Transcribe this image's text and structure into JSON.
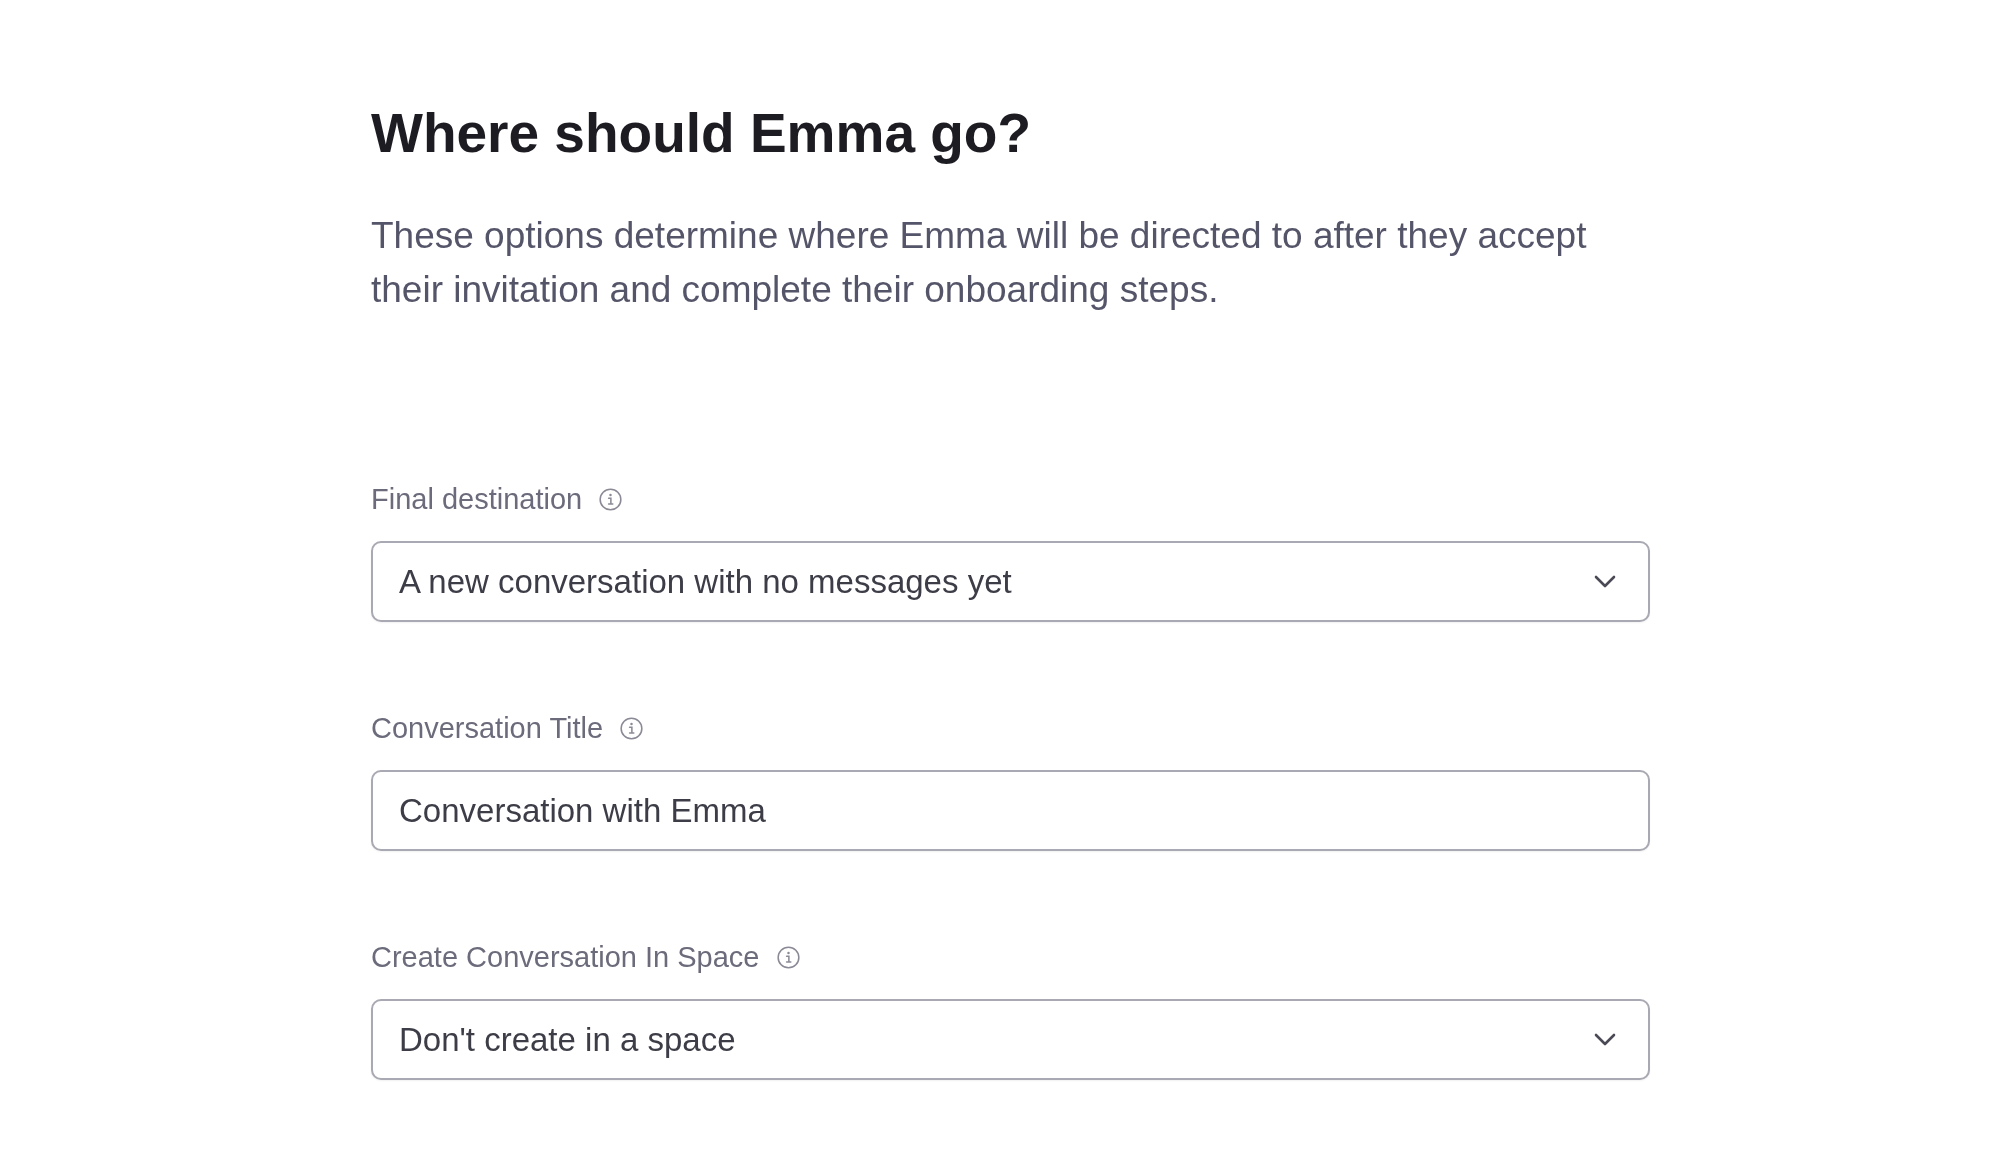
{
  "heading": "Where should Emma go?",
  "description": "These options determine where Emma will be directed to after they accept their invitation and complete their onboarding steps.",
  "fields": [
    {
      "kind": "select",
      "label": "Final destination",
      "value": "A new conversation with no messages yet"
    },
    {
      "kind": "text",
      "label": "Conversation Title",
      "value": "Conversation with Emma"
    },
    {
      "kind": "select",
      "label": "Create Conversation In Space",
      "value": "Don't create in a space"
    }
  ]
}
